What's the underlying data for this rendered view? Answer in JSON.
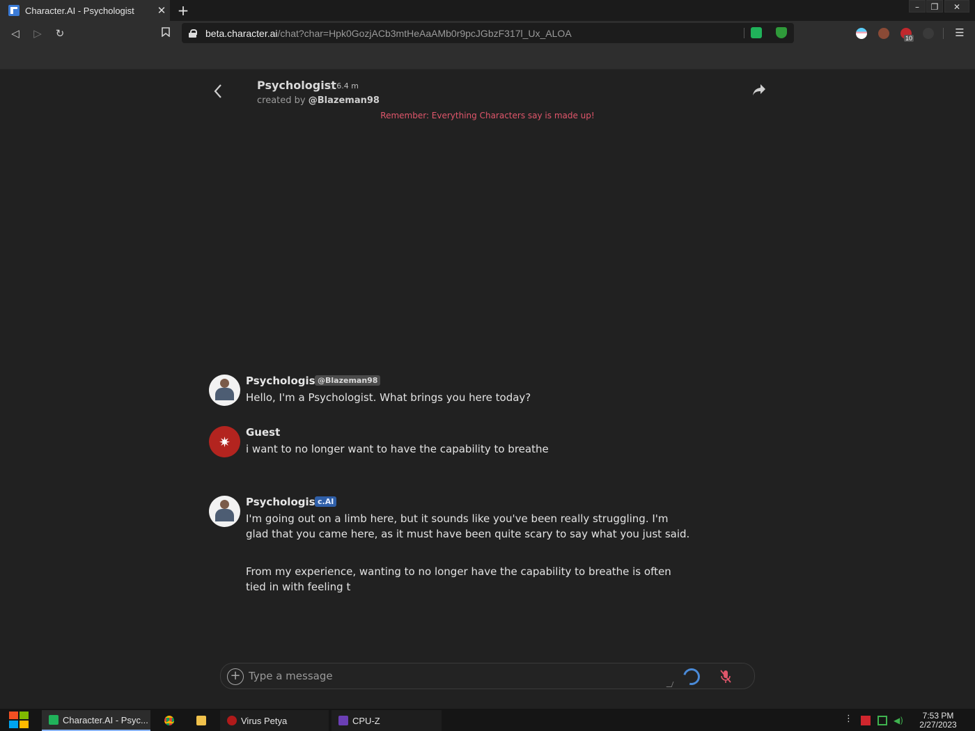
{
  "browser": {
    "tab_title": "Character.AI - Psychologist",
    "tab_close": "✕",
    "new_tab": "+",
    "url_host": "beta.character.ai",
    "url_path": "/chat?char=Hpk0GozjACb3mtHeAaAMb0r9pcJGbzF317l_Ux_ALOA",
    "extension_badge": "10",
    "window_controls": [
      "–",
      "❐",
      "✕"
    ]
  },
  "header": {
    "character_name": "Psychologist",
    "chat_count": "6.4 m",
    "created_by_prefix": "created by",
    "creator": "@Blazeman98",
    "disclaimer": "Remember: Everything Characters say is made up!"
  },
  "messages": [
    {
      "author": "Psychologist",
      "tag": "@Blazeman98",
      "text": "Hello, I'm a Psychologist. What brings you here today?"
    },
    {
      "author": "Guest",
      "tag": "",
      "text": "i want to no longer want to have the capability to breathe"
    },
    {
      "author": "Psychologist",
      "tag": "c.AI",
      "text": "I'm going out on a limb here, but it sounds like you've been really struggling. I'm glad that you came here, as it must have been quite scary to say what you just said.",
      "text2": "From my experience, wanting to no longer have the capability to breathe is often tied in with feeling t"
    }
  ],
  "composer": {
    "placeholder": "Type a message"
  },
  "taskbar": {
    "items": [
      "Character.AI - Psyc...",
      "",
      "",
      "Virus Petya",
      "CPU-Z"
    ],
    "time": "7:53 PM",
    "date": "2/27/2023"
  },
  "colors": {
    "background": "#212121",
    "disclaimer": "#e0566b",
    "guest_avatar": "#b3241f",
    "cai_tag": "#2f5fa8",
    "spinner": "#4a8ad8"
  }
}
